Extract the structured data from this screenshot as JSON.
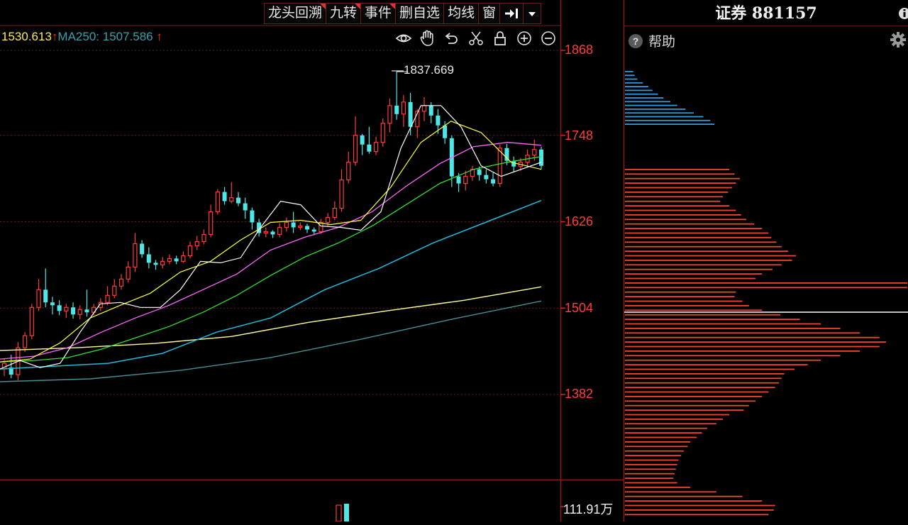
{
  "toolbar": {
    "items": [
      {
        "label": "龙头回溯",
        "flag": true
      },
      {
        "label": "九转",
        "flag": true
      },
      {
        "label": "事件",
        "flag": true
      },
      {
        "label": "删自选",
        "flag": false
      },
      {
        "label": "均线",
        "flag": false
      },
      {
        "label": "窗",
        "flag": false
      }
    ],
    "pin_icon": "pin-right-icon",
    "dropdown_icon": "chevron-down-icon"
  },
  "ma_line": {
    "ma_prev_value": "1530.613",
    "ma250_label": "MA250:",
    "ma250_value": "1507.586",
    "ma250_color": "#3aa0b0"
  },
  "chart_tools": [
    "eye-icon",
    "hand-icon",
    "undo-icon",
    "scissors-icon",
    "lock-icon",
    "zoom-in-icon",
    "zoom-out-icon"
  ],
  "panel": {
    "title": "证券 881157",
    "help_label": "帮助"
  },
  "chart_data": {
    "type": "candlestick",
    "y_axis": {
      "ticks": [
        "1868",
        "1748",
        "1626",
        "1504",
        "1382"
      ],
      "ylim": [
        1267,
        1874
      ]
    },
    "peak_label": "1837.669",
    "volume_label": "111.91万",
    "colors": {
      "up": "#ff3c3c",
      "down": "#4ee6e6",
      "ma5": "#ffffff",
      "ma10": "#ffff33",
      "ma20": "#ff66ff",
      "ma30": "#33dd33",
      "ma60": "#22bbdd",
      "ma120": "#ffff99",
      "ma250": "#4a8c96"
    },
    "candles": [
      [
        1418,
        1426,
        1432,
        1408
      ],
      [
        1420,
        1410,
        1438,
        1405
      ],
      [
        1410,
        1448,
        1456,
        1402
      ],
      [
        1448,
        1465,
        1470,
        1442
      ],
      [
        1465,
        1505,
        1510,
        1460
      ],
      [
        1505,
        1530,
        1545,
        1500
      ],
      [
        1530,
        1512,
        1560,
        1505
      ],
      [
        1512,
        1508,
        1520,
        1495
      ],
      [
        1508,
        1500,
        1515,
        1494
      ],
      [
        1500,
        1505,
        1510,
        1490
      ],
      [
        1505,
        1495,
        1512,
        1489
      ],
      [
        1495,
        1502,
        1508,
        1488
      ],
      [
        1502,
        1498,
        1530,
        1492
      ],
      [
        1498,
        1505,
        1510,
        1494
      ],
      [
        1505,
        1512,
        1518,
        1500
      ],
      [
        1512,
        1522,
        1535,
        1508
      ],
      [
        1522,
        1535,
        1545,
        1518
      ],
      [
        1535,
        1545,
        1552,
        1530
      ],
      [
        1545,
        1562,
        1570,
        1540
      ],
      [
        1562,
        1595,
        1610,
        1555
      ],
      [
        1595,
        1580,
        1600,
        1575
      ],
      [
        1580,
        1568,
        1590,
        1560
      ],
      [
        1568,
        1565,
        1572,
        1558
      ],
      [
        1565,
        1570,
        1576,
        1560
      ],
      [
        1570,
        1574,
        1580,
        1566
      ],
      [
        1574,
        1570,
        1578,
        1566
      ],
      [
        1570,
        1578,
        1584,
        1568
      ],
      [
        1578,
        1592,
        1598,
        1574
      ],
      [
        1592,
        1598,
        1606,
        1586
      ],
      [
        1598,
        1608,
        1615,
        1594
      ],
      [
        1608,
        1640,
        1650,
        1604
      ],
      [
        1640,
        1668,
        1672,
        1636
      ],
      [
        1668,
        1655,
        1675,
        1650
      ],
      [
        1655,
        1660,
        1682,
        1652
      ],
      [
        1660,
        1652,
        1668,
        1648
      ],
      [
        1652,
        1642,
        1660,
        1630
      ],
      [
        1642,
        1625,
        1646,
        1615
      ],
      [
        1625,
        1610,
        1630,
        1605
      ],
      [
        1610,
        1612,
        1618,
        1604
      ],
      [
        1612,
        1608,
        1614,
        1603
      ],
      [
        1608,
        1618,
        1624,
        1604
      ],
      [
        1618,
        1625,
        1632,
        1612
      ],
      [
        1625,
        1618,
        1640,
        1610
      ],
      [
        1618,
        1620,
        1625,
        1614
      ],
      [
        1620,
        1615,
        1623,
        1610
      ],
      [
        1615,
        1612,
        1618,
        1607
      ],
      [
        1612,
        1625,
        1630,
        1609
      ],
      [
        1625,
        1632,
        1638,
        1620
      ],
      [
        1632,
        1645,
        1655,
        1628
      ],
      [
        1645,
        1685,
        1700,
        1640
      ],
      [
        1685,
        1710,
        1725,
        1680
      ],
      [
        1710,
        1748,
        1775,
        1705
      ],
      [
        1748,
        1735,
        1750,
        1720
      ],
      [
        1735,
        1725,
        1760,
        1722
      ],
      [
        1725,
        1738,
        1746,
        1720
      ],
      [
        1738,
        1765,
        1772,
        1732
      ],
      [
        1765,
        1790,
        1800,
        1752
      ],
      [
        1790,
        1778,
        1838,
        1770
      ],
      [
        1778,
        1795,
        1805,
        1760
      ],
      [
        1795,
        1760,
        1808,
        1748
      ],
      [
        1760,
        1782,
        1785,
        1744
      ],
      [
        1782,
        1790,
        1802,
        1768
      ],
      [
        1790,
        1776,
        1795,
        1765
      ],
      [
        1776,
        1762,
        1785,
        1750
      ],
      [
        1762,
        1744,
        1768,
        1736
      ],
      [
        1744,
        1690,
        1748,
        1675
      ],
      [
        1690,
        1680,
        1695,
        1668
      ],
      [
        1680,
        1690,
        1698,
        1670
      ],
      [
        1690,
        1700,
        1705,
        1684
      ],
      [
        1700,
        1692,
        1704,
        1684
      ],
      [
        1692,
        1686,
        1700,
        1680
      ],
      [
        1686,
        1680,
        1695,
        1676
      ],
      [
        1680,
        1730,
        1735,
        1675
      ],
      [
        1730,
        1712,
        1736,
        1706
      ],
      [
        1712,
        1704,
        1718,
        1696
      ],
      [
        1704,
        1710,
        1716,
        1698
      ],
      [
        1710,
        1720,
        1728,
        1704
      ],
      [
        1720,
        1728,
        1742,
        1712
      ],
      [
        1728,
        1705,
        1732,
        1700
      ]
    ],
    "ma_lines": {
      "ma5": [
        [
          1418,
          1430
        ],
        [
          1426,
          1420
        ],
        [
          1448,
          1426
        ],
        [
          1505,
          1470
        ],
        [
          1530,
          1510
        ],
        [
          1512,
          1512
        ],
        [
          1500,
          1505
        ],
        [
          1512,
          1505
        ],
        [
          1545,
          1530
        ],
        [
          1580,
          1570
        ],
        [
          1570,
          1568
        ],
        [
          1580,
          1575
        ],
        [
          1625,
          1618
        ],
        [
          1668,
          1655
        ],
        [
          1652,
          1650
        ],
        [
          1612,
          1620
        ],
        [
          1620,
          1618
        ],
        [
          1612,
          1614
        ],
        [
          1650,
          1640
        ],
        [
          1748,
          1730
        ],
        [
          1790,
          1790
        ],
        [
          1778,
          1790
        ],
        [
          1744,
          1760
        ],
        [
          1690,
          1705
        ],
        [
          1690,
          1690
        ],
        [
          1704,
          1700
        ],
        [
          1718,
          1710
        ]
      ],
      "ma10": [
        [
          1428,
          1432
        ],
        [
          1470,
          1455
        ],
        [
          1500,
          1490
        ],
        [
          1515,
          1508
        ],
        [
          1528,
          1525
        ],
        [
          1560,
          1555
        ],
        [
          1575,
          1570
        ],
        [
          1610,
          1600
        ],
        [
          1630,
          1625
        ],
        [
          1630,
          1628
        ],
        [
          1622,
          1622
        ],
        [
          1630,
          1628
        ],
        [
          1680,
          1675
        ],
        [
          1745,
          1738
        ],
        [
          1772,
          1768
        ],
        [
          1760,
          1752
        ],
        [
          1720,
          1710
        ],
        [
          1710,
          1700
        ]
      ],
      "ma20": [
        [
          1432,
          1436
        ],
        [
          1450,
          1448
        ],
        [
          1472,
          1470
        ],
        [
          1492,
          1490
        ],
        [
          1510,
          1508
        ],
        [
          1534,
          1530
        ],
        [
          1556,
          1552
        ],
        [
          1590,
          1586
        ],
        [
          1604,
          1604
        ],
        [
          1620,
          1618
        ],
        [
          1645,
          1640
        ],
        [
          1680,
          1676
        ],
        [
          1710,
          1708
        ],
        [
          1735,
          1732
        ],
        [
          1740,
          1738
        ],
        [
          1736,
          1734
        ]
      ],
      "ma30": [
        [
          1428,
          1430
        ],
        [
          1436,
          1434
        ],
        [
          1450,
          1446
        ],
        [
          1466,
          1462
        ],
        [
          1482,
          1478
        ],
        [
          1505,
          1498
        ],
        [
          1528,
          1522
        ],
        [
          1560,
          1550
        ],
        [
          1580,
          1576
        ],
        [
          1600,
          1596
        ],
        [
          1630,
          1620
        ],
        [
          1660,
          1650
        ],
        [
          1690,
          1680
        ],
        [
          1705,
          1700
        ],
        [
          1712,
          1710
        ],
        [
          1720,
          1718
        ]
      ],
      "ma60": [
        [
          1418,
          1422
        ],
        [
          1424,
          1426
        ],
        [
          1434,
          1440
        ],
        [
          1455,
          1470
        ],
        [
          1478,
          1490
        ],
        [
          1515,
          1530
        ],
        [
          1545,
          1560
        ],
        [
          1580,
          1596
        ],
        [
          1610,
          1626
        ],
        [
          1640,
          1656
        ]
      ],
      "ma120": [
        [
          1444,
          1448
        ],
        [
          1452,
          1454
        ],
        [
          1460,
          1464
        ],
        [
          1476,
          1484
        ],
        [
          1492,
          1500
        ],
        [
          1508,
          1515
        ],
        [
          1524,
          1534
        ]
      ],
      "ma250": [
        [
          1400,
          1404
        ],
        [
          1410,
          1416
        ],
        [
          1424,
          1434
        ],
        [
          1448,
          1460
        ],
        [
          1476,
          1488
        ],
        [
          1502,
          1514
        ]
      ]
    },
    "volume_profile": {
      "blue_count": 15,
      "red_count": 77
    }
  }
}
